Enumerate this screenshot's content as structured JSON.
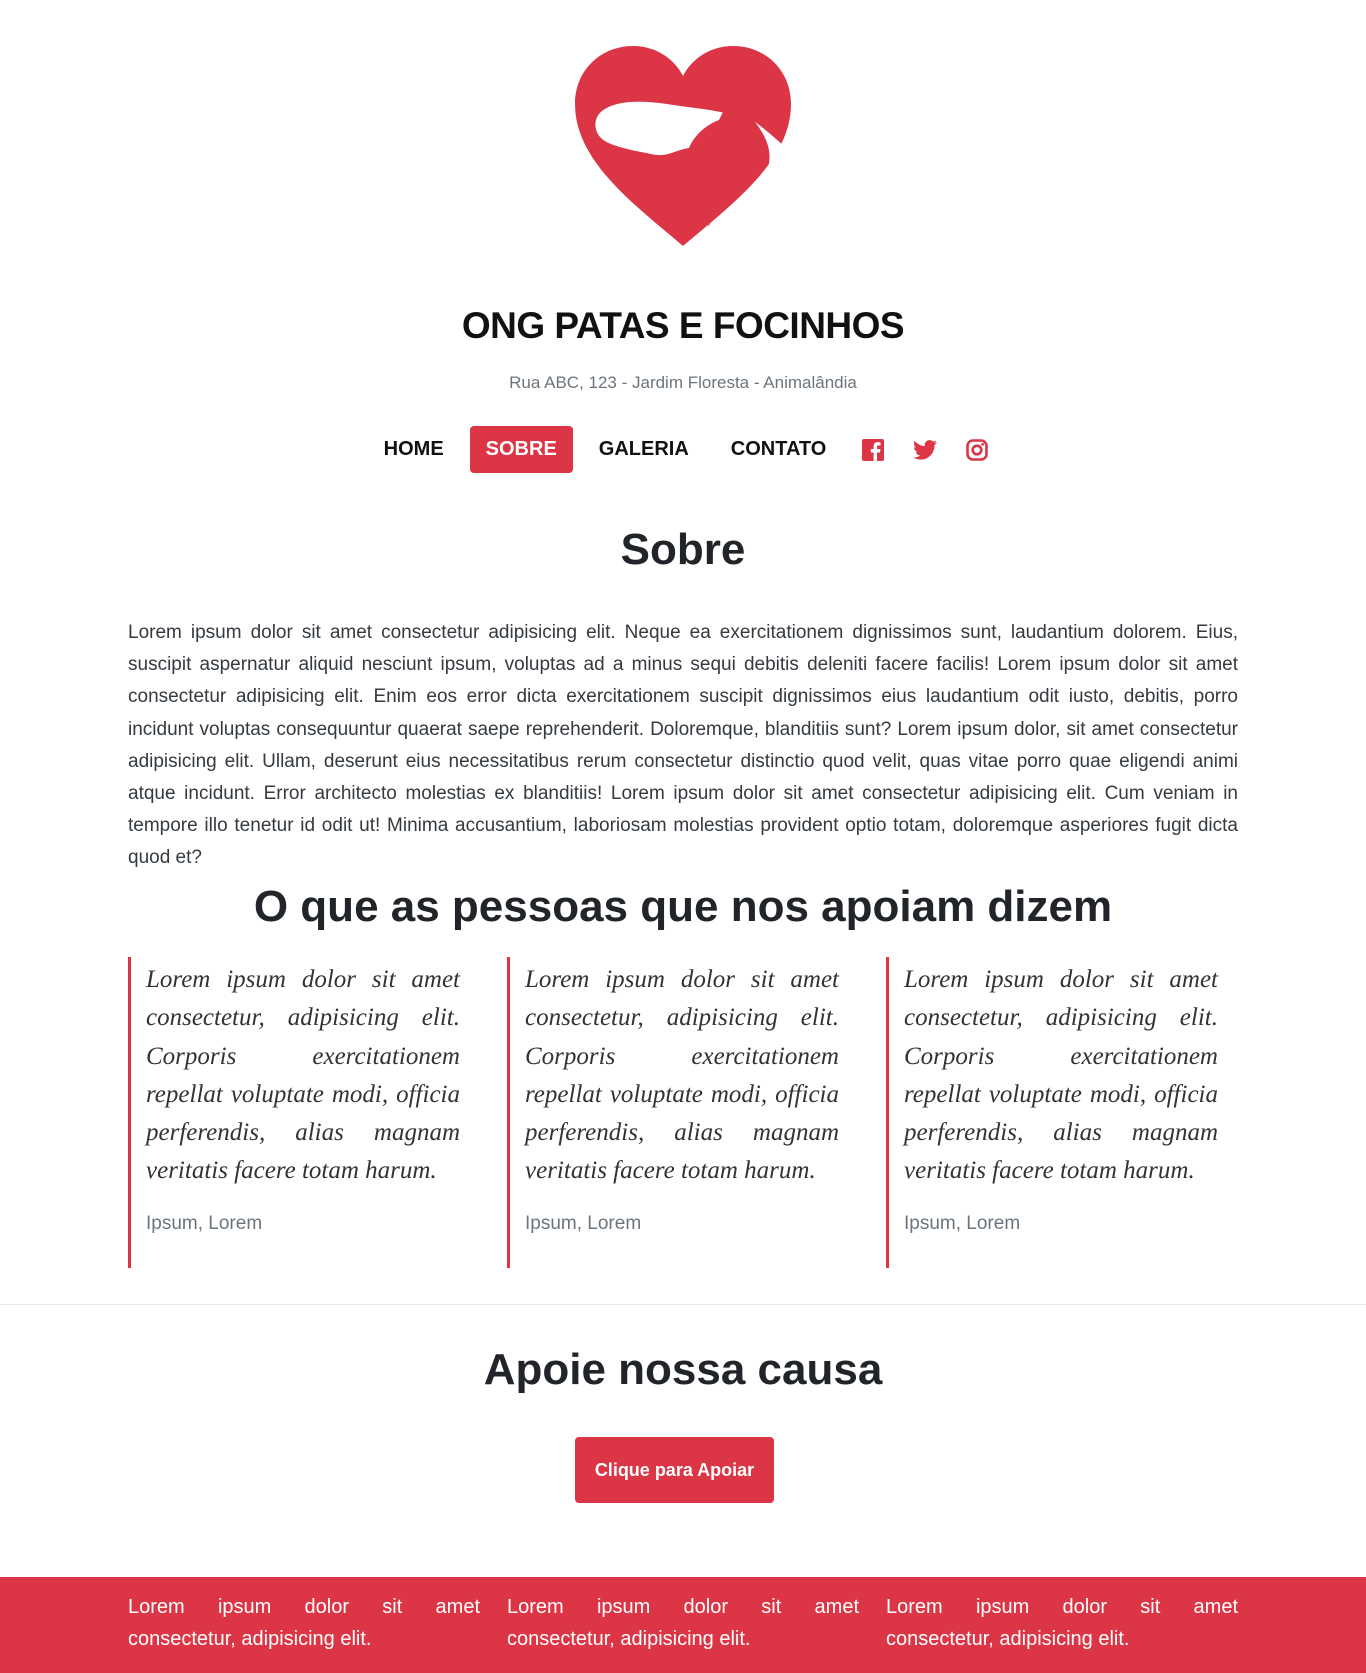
{
  "brand": {
    "title": "ONG PATAS E FOCINHOS",
    "address": "Rua ABC, 123 - Jardim Floresta - Animalândia",
    "logo_icon": "heart-dog-cat-logo"
  },
  "colors": {
    "accent": "#dc3545",
    "text": "#212529",
    "muted": "#6c757d"
  },
  "nav": {
    "items": [
      {
        "label": "HOME",
        "active": false
      },
      {
        "label": "SOBRE",
        "active": true
      },
      {
        "label": "GALERIA",
        "active": false
      },
      {
        "label": "CONTATO",
        "active": false
      }
    ],
    "social": [
      "facebook-icon",
      "twitter-icon",
      "instagram-icon"
    ]
  },
  "sobre": {
    "heading": "Sobre",
    "text": "Lorem ipsum dolor sit amet consectetur adipisicing elit. Neque ea exercitationem dignissimos sunt, laudantium dolorem. Eius, suscipit aspernatur aliquid nesciunt ipsum, voluptas ad a minus sequi debitis deleniti facere facilis! Lorem ipsum dolor sit amet consectetur adipisicing elit. Enim eos error dicta exercitationem suscipit dignissimos eius laudantium odit iusto, debitis, porro incidunt voluptas consequuntur quaerat saepe reprehenderit. Doloremque, blanditiis sunt? Lorem ipsum dolor, sit amet consectetur adipisicing elit. Ullam, deserunt eius necessitatibus rerum consectetur distinctio quod velit, quas vitae porro quae eligendi animi atque incidunt. Error architecto molestias ex blanditiis! Lorem ipsum dolor sit amet consectetur adipisicing elit. Cum veniam in tempore illo tenetur id odit ut! Minima accusantium, laboriosam molestias provident optio totam, doloremque asperiores fugit dicta quod et?"
  },
  "testimonials": {
    "heading": "O que as pessoas que nos apoiam dizem",
    "items": [
      {
        "quote": "Lorem ipsum dolor sit amet consectetur, adipisicing elit. Corporis exercitationem repellat voluptate modi, officia perferendis, alias magnam veritatis facere totam harum.",
        "author": "Ipsum, Lorem"
      },
      {
        "quote": "Lorem ipsum dolor sit amet consectetur, adipisicing elit. Corporis exercitationem repellat voluptate modi, officia perferendis, alias magnam veritatis facere totam harum.",
        "author": "Ipsum, Lorem"
      },
      {
        "quote": "Lorem ipsum dolor sit amet consectetur, adipisicing elit. Corporis exercitationem repellat voluptate modi, officia perferendis, alias magnam veritatis facere totam harum.",
        "author": "Ipsum, Lorem"
      }
    ]
  },
  "apoie": {
    "heading": "Apoie nossa causa",
    "button": "Clique para Apoiar"
  },
  "footer": {
    "columns": [
      "Lorem ipsum dolor sit amet consectetur, adipisicing elit.",
      "Lorem ipsum dolor sit amet consectetur, adipisicing elit.",
      "Lorem ipsum dolor sit amet consectetur, adipisicing elit."
    ]
  }
}
